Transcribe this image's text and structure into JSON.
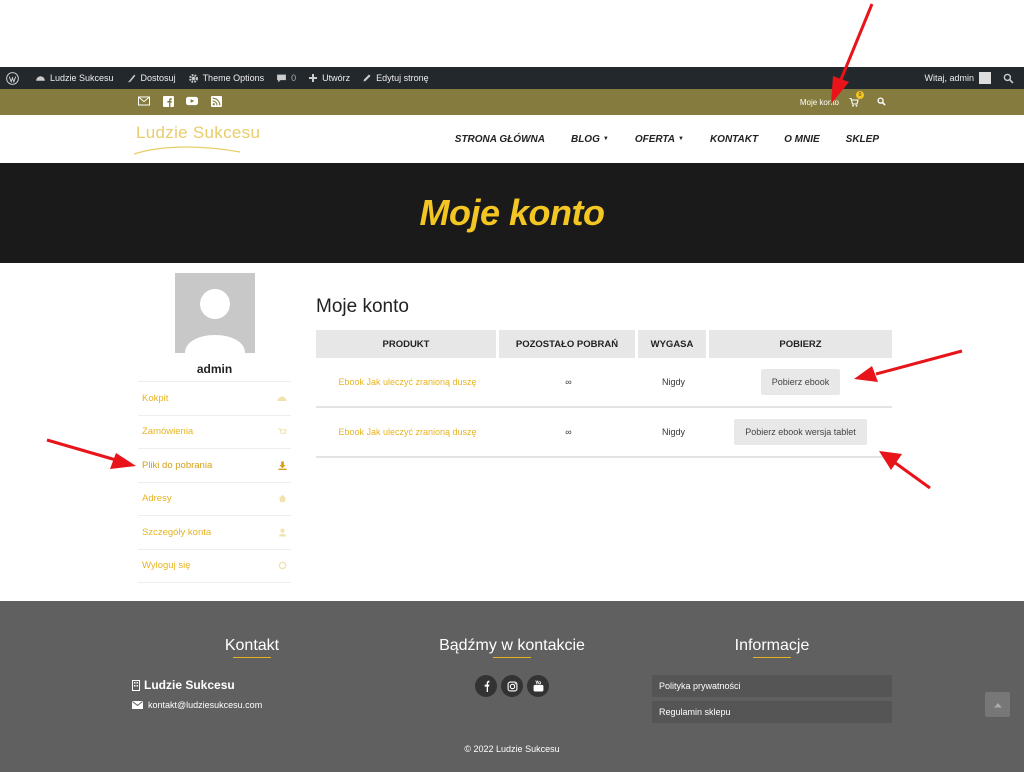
{
  "admin_bar": {
    "site_name": "Ludzie Sukcesu",
    "customize": "Dostosuj",
    "theme_options": "Theme Options",
    "comments_count": "0",
    "new": "Utwórz",
    "edit_page": "Edytuj stronę",
    "greeting": "Witaj, admin"
  },
  "top_bar": {
    "account_link": "Moje konto",
    "cart_count": "0",
    "social_icons": [
      "mail-icon",
      "facebook-icon",
      "youtube-icon",
      "rss-icon"
    ]
  },
  "header": {
    "logo_text": "Ludzie Sukcesu",
    "nav": [
      {
        "label": "STRONA GŁÓWNA",
        "dropdown": false
      },
      {
        "label": "BLOG",
        "dropdown": true
      },
      {
        "label": "OFERTA",
        "dropdown": true
      },
      {
        "label": "KONTAKT",
        "dropdown": false
      },
      {
        "label": "O MNIE",
        "dropdown": false
      },
      {
        "label": "SKLEP",
        "dropdown": false
      }
    ]
  },
  "hero": {
    "title": "Moje konto"
  },
  "sidebar": {
    "username": "admin",
    "items": [
      {
        "label": "Kokpit",
        "icon": "dashboard-icon"
      },
      {
        "label": "Zamówienia",
        "icon": "cart-icon"
      },
      {
        "label": "Pliki do pobrania",
        "icon": "download-icon",
        "active": true
      },
      {
        "label": "Adresy",
        "icon": "home-icon"
      },
      {
        "label": "Szczegóły konta",
        "icon": "user-icon"
      },
      {
        "label": "Wyloguj się",
        "icon": "logout-icon"
      }
    ]
  },
  "content": {
    "title": "Moje konto",
    "table": {
      "headers": [
        "PRODUKT",
        "POZOSTAŁO POBRAŃ",
        "WYGASA",
        "POBIERZ"
      ],
      "rows": [
        {
          "product": "Ebook Jak uleczyć zranioną duszę",
          "remaining": "∞",
          "expires": "Nigdy",
          "button": "Pobierz ebook"
        },
        {
          "product": "Ebook Jak uleczyć zranioną duszę",
          "remaining": "∞",
          "expires": "Nigdy",
          "button": "Pobierz ebook wersja tablet"
        }
      ]
    }
  },
  "footer": {
    "contact_title": "Kontakt",
    "social_title": "Bądźmy w kontakcie",
    "info_title": "Informacje",
    "contact_name": "Ludzie Sukcesu",
    "contact_email": "kontakt@ludziesukcesu.com",
    "social_icons": [
      "facebook-icon",
      "instagram-icon",
      "youtube-icon"
    ],
    "info_links": [
      "Polityka prywatności",
      "Regulamin sklepu"
    ],
    "copyright": "© 2022 Ludzie Sukcesu"
  },
  "colors": {
    "accent": "#e6b422",
    "top_bar": "#857b3e",
    "admin_bar": "#23282d",
    "hero_bg": "#1a1a1a",
    "footer_bg": "#606060",
    "annotation_arrow": "#e8141a"
  }
}
